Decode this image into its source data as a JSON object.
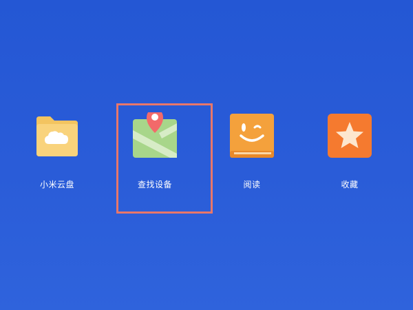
{
  "apps": [
    {
      "id": "cloud",
      "label": "小米云盘",
      "icon": "cloud-folder-icon"
    },
    {
      "id": "find",
      "label": "查找设备",
      "icon": "map-pin-icon"
    },
    {
      "id": "read",
      "label": "阅读",
      "icon": "book-smile-icon"
    },
    {
      "id": "fav",
      "label": "收藏",
      "icon": "star-icon"
    }
  ],
  "highlight": {
    "target": "查找设备",
    "color": "#e8776a"
  },
  "colors": {
    "background": "#2a5cd8",
    "folder": "#f7cf73",
    "map_green": "#a8d68a",
    "map_pin": "#f26a6a",
    "book": "#f4a13c",
    "star_bg": "#f57a2f"
  }
}
